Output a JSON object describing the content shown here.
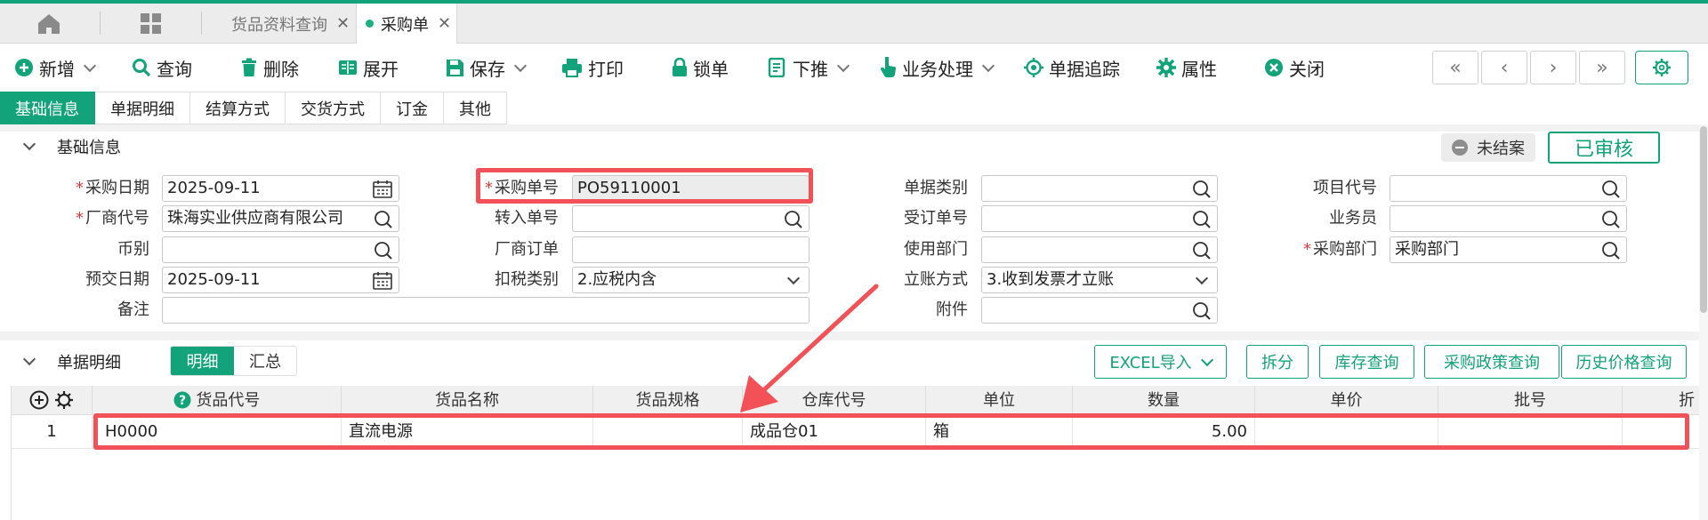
{
  "tabs": [
    {
      "label": "货品资料查询"
    },
    {
      "label": "采购单"
    }
  ],
  "toolbar": [
    {
      "label": "新增",
      "icon": "plus-circle-icon"
    },
    {
      "label": "查询",
      "icon": "search-icon"
    },
    {
      "label": "删除",
      "icon": "trash-icon"
    },
    {
      "label": "展开",
      "icon": "book-icon"
    },
    {
      "label": "保存",
      "icon": "save-icon"
    },
    {
      "label": "打印",
      "icon": "printer-icon"
    },
    {
      "label": "锁单",
      "icon": "lock-icon"
    },
    {
      "label": "下推",
      "icon": "push-down-icon"
    },
    {
      "label": "业务处理",
      "icon": "hand-pointer-icon"
    },
    {
      "label": "单据追踪",
      "icon": "target-icon"
    },
    {
      "label": "属性",
      "icon": "gear-icon"
    },
    {
      "label": "关闭",
      "icon": "close-circle-icon"
    }
  ],
  "nav": {
    "first": "«",
    "prev": "‹",
    "next": "›",
    "last": "»"
  },
  "subtabs": [
    {
      "label": "基础信息"
    },
    {
      "label": "单据明细"
    },
    {
      "label": "结算方式"
    },
    {
      "label": "交货方式"
    },
    {
      "label": "订金"
    },
    {
      "label": "其他"
    }
  ],
  "basic": {
    "title": "基础信息",
    "status": "未结案",
    "approved": "已审核",
    "fields": {
      "purchase_date": {
        "label": "采购日期",
        "value": "2025-09-11"
      },
      "vendor_code": {
        "label": "厂商代号",
        "value": "珠海实业供应商有限公司"
      },
      "currency": {
        "label": "币别",
        "value": ""
      },
      "delivery_date": {
        "label": "预交日期",
        "value": "2025-09-11"
      },
      "remark": {
        "label": "备注",
        "value": ""
      },
      "po_number": {
        "label": "采购单号",
        "value": "PO59110001"
      },
      "transfer_no": {
        "label": "转入单号",
        "value": ""
      },
      "vendor_order": {
        "label": "厂商订单",
        "value": ""
      },
      "tax_type": {
        "label": "扣税类别",
        "value": "2.应税内含"
      },
      "doc_type": {
        "label": "单据类别",
        "value": ""
      },
      "order_no": {
        "label": "受订单号",
        "value": ""
      },
      "use_dept": {
        "label": "使用部门",
        "value": ""
      },
      "account_method": {
        "label": "立账方式",
        "value": "3.收到发票才立账"
      },
      "attachment": {
        "label": "附件",
        "value": ""
      },
      "project_code": {
        "label": "项目代号",
        "value": ""
      },
      "salesperson": {
        "label": "业务员",
        "value": ""
      },
      "purchase_dept": {
        "label": "采购部门",
        "value": "采购部门"
      }
    }
  },
  "detail": {
    "title": "单据明细",
    "seg": [
      "明细",
      "汇总"
    ],
    "buttons": [
      "EXCEL导入",
      "拆分",
      "库存查询",
      "采购政策查询",
      "历史价格查询"
    ],
    "columns": [
      "货品代号",
      "货品名称",
      "货品规格",
      "仓库代号",
      "单位",
      "数量",
      "单价",
      "批号",
      "折"
    ],
    "rows": [
      {
        "idx": "1",
        "code": "H0000",
        "name": "直流电源",
        "spec": "",
        "warehouse": "成品仓01",
        "unit": "箱",
        "qty": "5.00",
        "price": "",
        "batch": ""
      }
    ]
  },
  "colors": {
    "accent": "#12a37a",
    "highlight": "#f25157",
    "required": "#e23b3b"
  }
}
